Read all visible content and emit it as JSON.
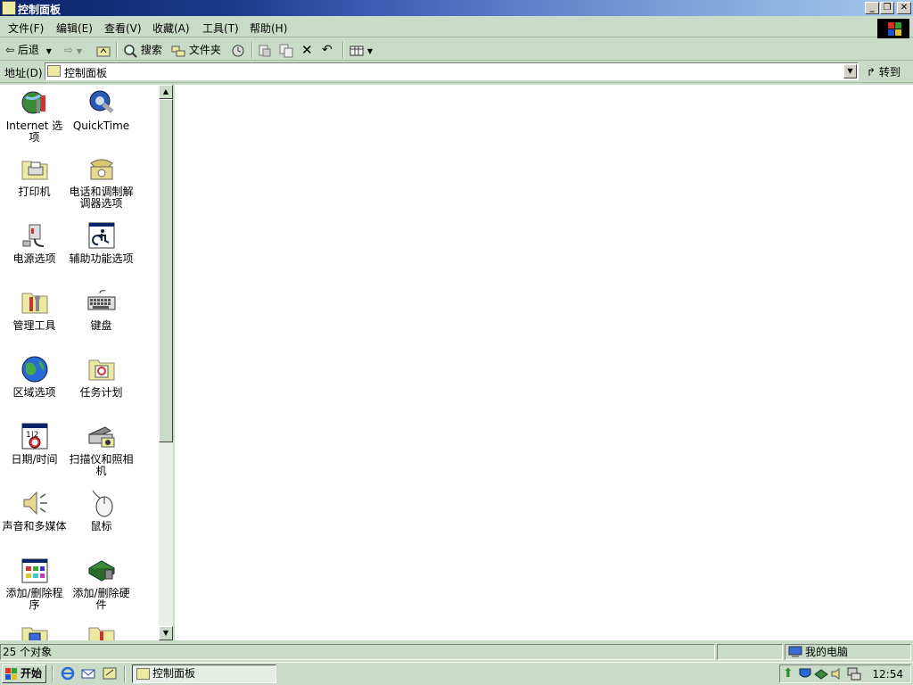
{
  "window": {
    "title": "控制面板"
  },
  "menu": [
    "文件(F)",
    "编辑(E)",
    "查看(V)",
    "收藏(A)",
    "工具(T)",
    "帮助(H)"
  ],
  "toolbar": {
    "back": "后退",
    "search": "搜索",
    "folders": "文件夹"
  },
  "address": {
    "label": "地址(D)",
    "value": "控制面板",
    "go": "转到"
  },
  "items": [
    {
      "label": "Internet 选项",
      "icon": "internet-options-icon"
    },
    {
      "label": "QuickTime",
      "icon": "quicktime-icon"
    },
    {
      "label": "打印机",
      "icon": "printers-icon"
    },
    {
      "label": "电话和调制解调器选项",
      "icon": "phone-modem-icon"
    },
    {
      "label": "电源选项",
      "icon": "power-options-icon"
    },
    {
      "label": "辅助功能选项",
      "icon": "accessibility-icon"
    },
    {
      "label": "管理工具",
      "icon": "admin-tools-icon"
    },
    {
      "label": "键盘",
      "icon": "keyboard-icon"
    },
    {
      "label": "区域选项",
      "icon": "regional-options-icon"
    },
    {
      "label": "任务计划",
      "icon": "scheduled-tasks-icon"
    },
    {
      "label": "日期/时间",
      "icon": "date-time-icon"
    },
    {
      "label": "扫描仪和照相机",
      "icon": "scanner-camera-icon"
    },
    {
      "label": "声音和多媒体",
      "icon": "sound-multimedia-icon"
    },
    {
      "label": "鼠标",
      "icon": "mouse-icon"
    },
    {
      "label": "添加/删除程序",
      "icon": "add-remove-programs-icon"
    },
    {
      "label": "添加/删除硬件",
      "icon": "add-remove-hardware-icon"
    }
  ],
  "status": {
    "count": "25 个对象",
    "location": "我的电脑"
  },
  "taskbar": {
    "start": "开始",
    "task": "控制面板",
    "clock": "12:54"
  }
}
